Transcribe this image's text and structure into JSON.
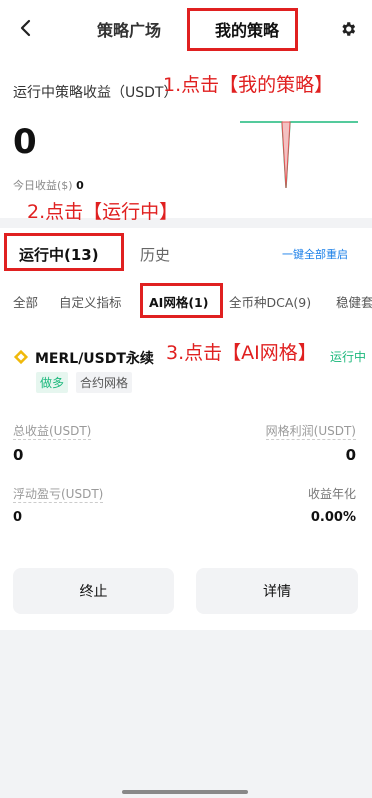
{
  "header": {
    "back_label": "<",
    "tab_square": "策略广场",
    "tab_mine": "我的策略"
  },
  "summary": {
    "title": "运行中策略收益（USDT）",
    "total_value": "0",
    "today_label": "今日收益($)",
    "today_value": "0"
  },
  "tabs": {
    "running": "运行中(13)",
    "history": "历史",
    "restart_all": "一键全部重启"
  },
  "filters": [
    "全部",
    "自定义指标",
    "AI网格(1)",
    "全币种DCA(9)",
    "稳健套"
  ],
  "strategy": {
    "pair": "MERL/USDT永续",
    "status": "运行中",
    "tag_direction": "做多",
    "tag_type": "合约网格",
    "total_profit_label": "总收益(USDT)",
    "total_profit_value": "0",
    "grid_profit_label": "网格利润(USDT)",
    "grid_profit_value": "0",
    "floating_label": "浮动盈亏(USDT)",
    "floating_value": "0",
    "annual_label": "收益年化",
    "annual_value": "0.00%",
    "stop_button": "终止",
    "detail_button": "详情"
  },
  "annotations": {
    "step1": "1.点击【我的策略】",
    "step2": "2.点击【运行中】",
    "step3": "3.点击【AI网格】"
  },
  "colors": {
    "annotation": "#e02020",
    "positive": "#1cb87c",
    "link": "#1a7fe8"
  }
}
